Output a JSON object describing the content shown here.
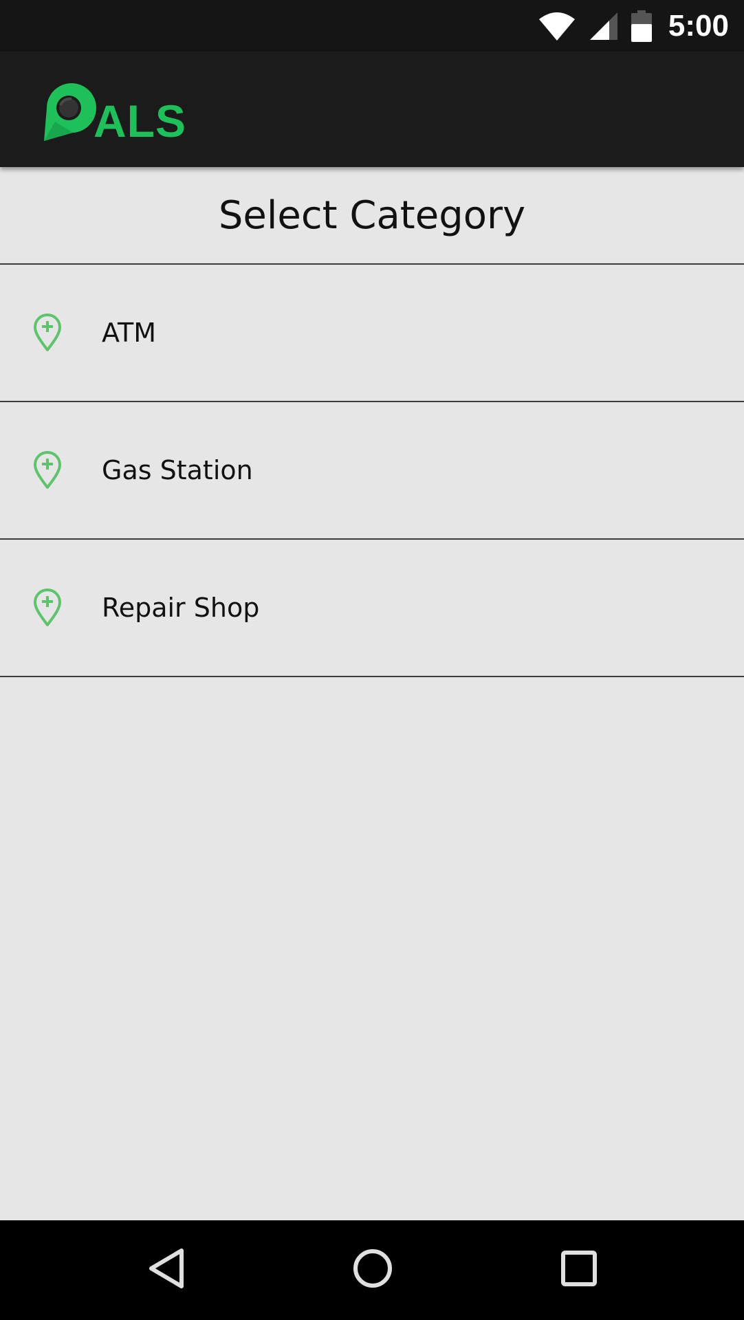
{
  "status_bar": {
    "time": "5:00",
    "icons": [
      "wifi-icon",
      "cell-signal-icon",
      "battery-icon"
    ]
  },
  "app_bar": {
    "logo_text": "ALS",
    "brand_color": "#1ec05a"
  },
  "page": {
    "title": "Select Category"
  },
  "categories": [
    {
      "label": "ATM",
      "icon": "map-pin-plus-icon"
    },
    {
      "label": "Gas Station",
      "icon": "map-pin-plus-icon"
    },
    {
      "label": "Repair Shop",
      "icon": "map-pin-plus-icon"
    }
  ],
  "nav_bar": {
    "buttons": [
      "back-icon",
      "home-icon",
      "recents-icon"
    ]
  },
  "colors": {
    "background": "#e6e6e6",
    "status_bar": "#151515",
    "app_bar": "#1b1b1b",
    "pin_green": "#5cc46a",
    "divider": "#3a3a3a"
  }
}
